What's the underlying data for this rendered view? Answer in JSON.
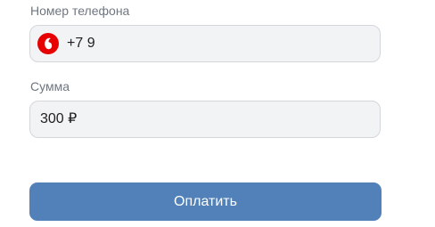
{
  "form": {
    "phone": {
      "label": "Номер телефона",
      "value": "+7 9",
      "operator_icon": "vodafone-logo-icon",
      "operator_color": "#e60000"
    },
    "amount": {
      "label": "Сумма",
      "value": "300 ₽"
    },
    "submit_label": "Оплатить"
  },
  "colors": {
    "button": "#5181b8",
    "field_background": "#f2f3f5",
    "field_border": "#d3d6db",
    "label": "#6f7680"
  }
}
